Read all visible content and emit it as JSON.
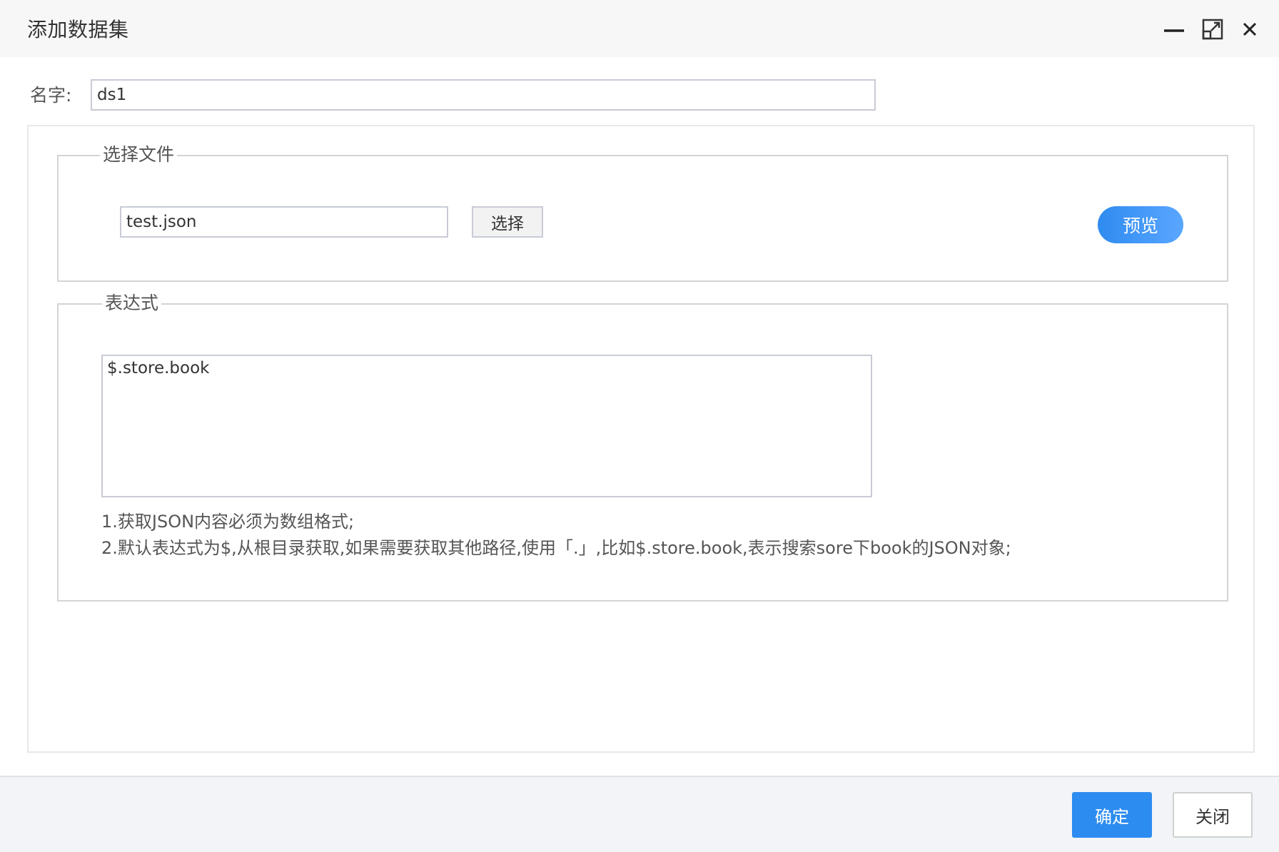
{
  "window": {
    "title": "添加数据集",
    "controls": [
      "minimize-icon",
      "maximize-icon",
      "close-icon"
    ]
  },
  "name_field": {
    "label": "名字:",
    "value": "ds1"
  },
  "file_section": {
    "legend": "选择文件",
    "file_value": "test.json",
    "choose_label": "选择",
    "preview_label": "预览"
  },
  "expression_section": {
    "legend": "表达式",
    "value": "$.store.book",
    "hints": [
      "1.获取JSON内容必须为数组格式;",
      "2.默认表达式为$,从根目录获取,如果需要获取其他路径,使用「.」,比如$.store.book,表示搜索sore下book的JSON对象;"
    ]
  },
  "footer": {
    "ok_label": "确定",
    "close_label": "关闭"
  },
  "colors": {
    "primary": "#2d8cf0",
    "titlebar_bg": "#f7f7f7",
    "footer_bg": "#f2f4f7"
  }
}
